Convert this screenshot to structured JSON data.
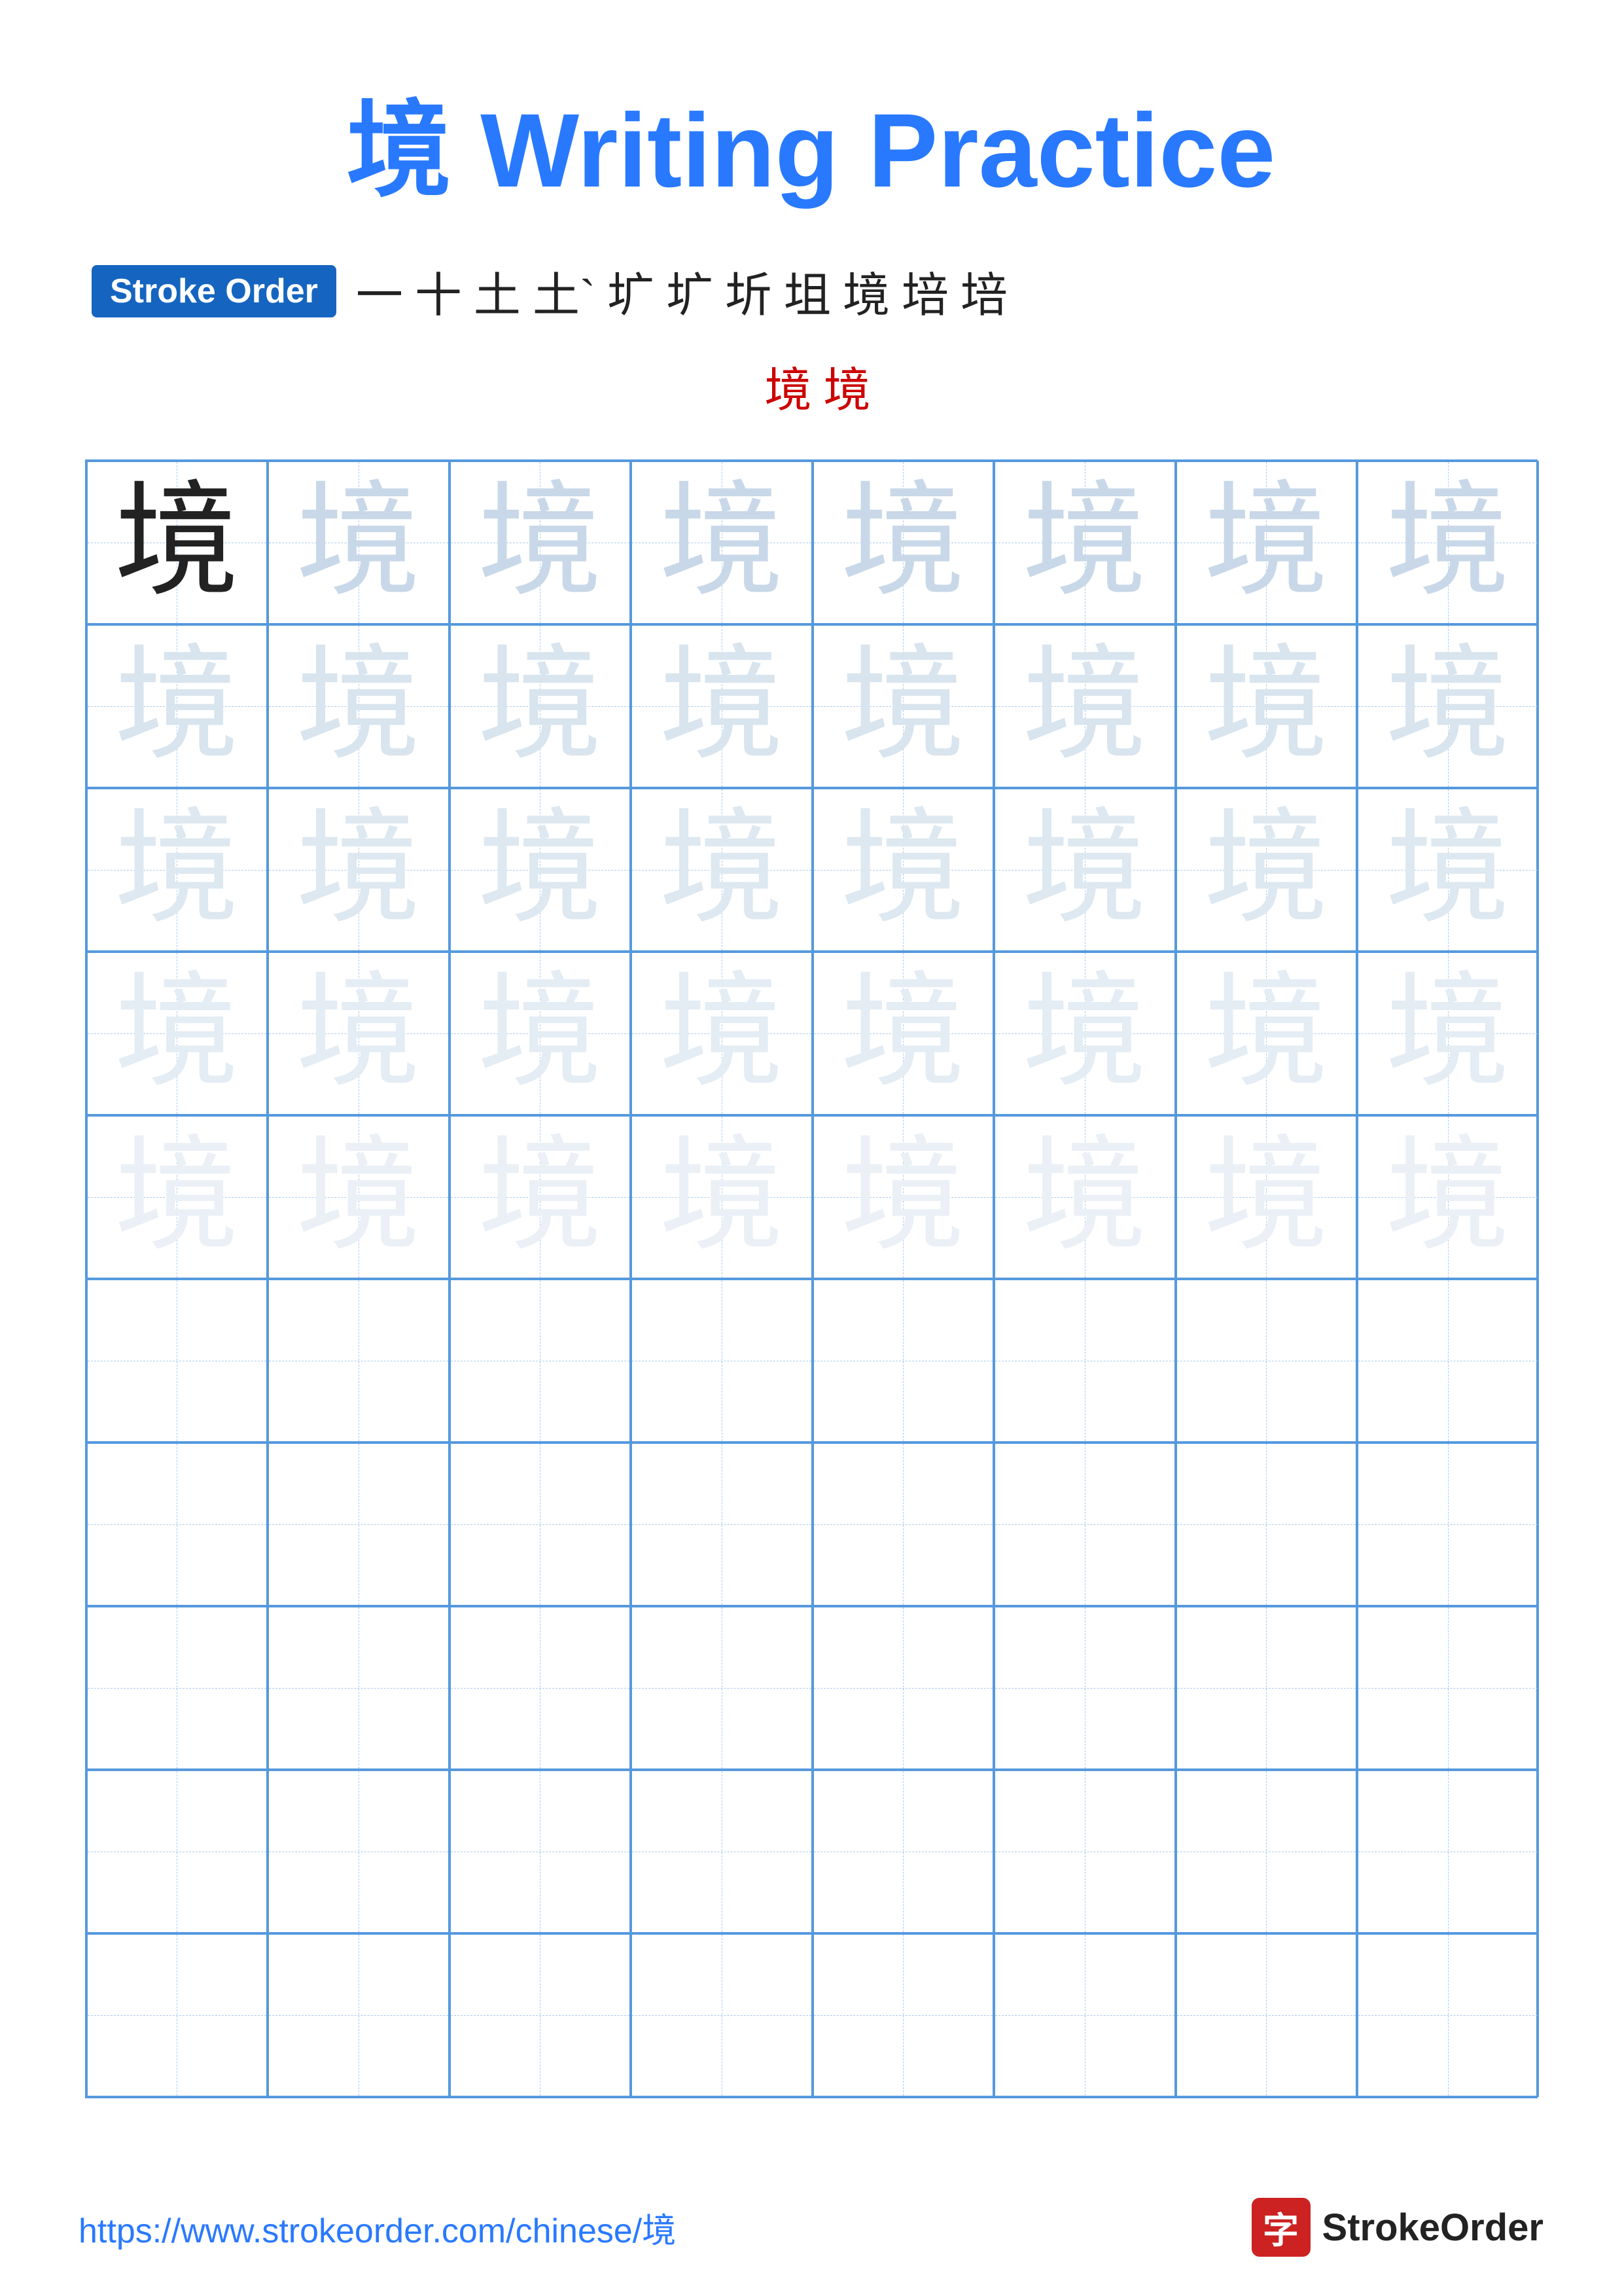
{
  "title": {
    "char": "境",
    "label": " Writing Practice"
  },
  "stroke_order": {
    "badge": "Stroke Order",
    "strokes": [
      "一",
      "十",
      "土",
      "土`",
      "圹",
      "圹",
      "圻",
      "坥",
      "境",
      "培",
      "培"
    ],
    "row2": [
      "境",
      "境"
    ]
  },
  "grid": {
    "rows": 10,
    "cols": 8,
    "char": "境",
    "filled_rows": 5
  },
  "footer": {
    "url": "https://www.strokeorder.com/chinese/境",
    "logo_char": "字",
    "logo_text": "StrokeOrder"
  }
}
